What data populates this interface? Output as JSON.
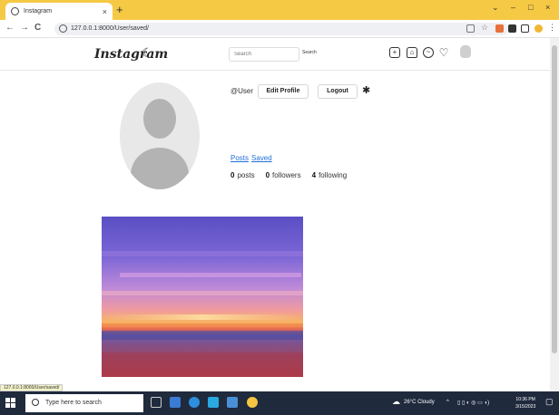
{
  "browser": {
    "tab_title": "Instagram",
    "tab_close": "×",
    "new_tab": "+",
    "url": "127.0.0.1:8000/User/saved/",
    "controls": {
      "minimize": "–",
      "maximize": "□",
      "close": "×",
      "dropdown": "⌄"
    },
    "nav": {
      "back": "←",
      "forward": "→",
      "reload": "C"
    }
  },
  "app": {
    "logo": "Instagram",
    "theme_icon": "☾",
    "search_placeholder": "Search",
    "search_button": "Search",
    "nav_icons": [
      "plus-circle-icon",
      "home-icon",
      "messenger-icon",
      "heart-icon"
    ]
  },
  "profile": {
    "username": "@User",
    "edit_profile": "Edit Profile",
    "logout": "Logout",
    "settings_icon": "✱",
    "tabs": [
      "Posts",
      "Saved"
    ],
    "stats": [
      {
        "count": "0",
        "label": "posts"
      },
      {
        "count": "0",
        "label": "followers"
      },
      {
        "count": "4",
        "label": "following"
      }
    ]
  },
  "status_url": "127.0.0.1:8000/User/saved/",
  "taskbar": {
    "search_placeholder": "Type here to search",
    "weather": "26°C Cloudy",
    "time": "10:36 PM",
    "date": "3/15/2023"
  },
  "colors": {
    "tabbar": "#f6c944",
    "link": "#1e6fd9",
    "taskbar": "#1f2a3d"
  }
}
